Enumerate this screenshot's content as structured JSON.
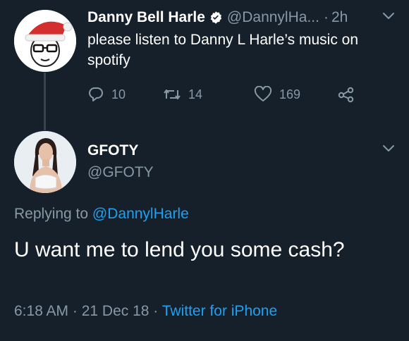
{
  "parent_tweet": {
    "display_name": "Danny Bell Harle",
    "handle": "@DannylHa...",
    "separator": "·",
    "time": "2h",
    "text": "please listen to Danny L Harle’s music on spotify",
    "stats": {
      "replies": "10",
      "retweets": "14",
      "likes": "169"
    },
    "verified": true
  },
  "reply_tweet": {
    "display_name": "GFOTY",
    "handle": "@GFOTY",
    "replying_prefix": "Replying to",
    "replying_mention": "@DannylHarle",
    "text": "U want me to lend you some cash?",
    "timestamp": "6:18 AM · 21 Dec 18 ·",
    "source": "Twitter for iPhone"
  },
  "icons": {
    "verified": "verified-badge-icon",
    "more": "chevron-down-icon",
    "reply": "reply-icon",
    "retweet": "retweet-icon",
    "like": "heart-icon",
    "share": "share-icon"
  },
  "colors": {
    "background": "#15202b",
    "primary_text": "#ffffff",
    "secondary_text": "#8899a6",
    "accent": "#1da1f2",
    "thread_line": "#38444d"
  }
}
